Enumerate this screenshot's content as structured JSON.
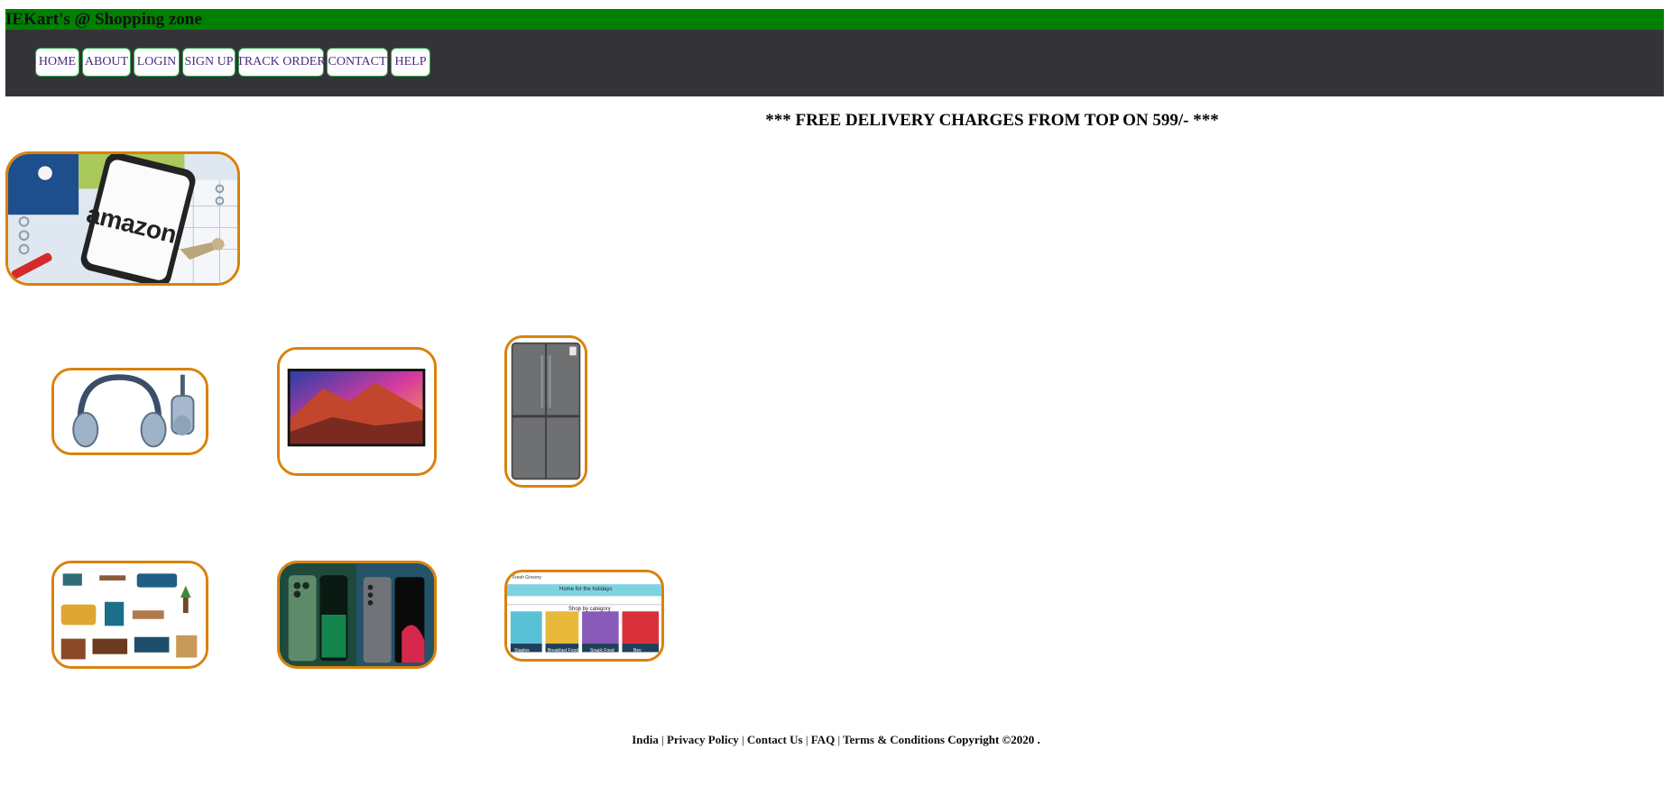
{
  "header": {
    "brand": "IEKart's @ Shopping zone"
  },
  "nav": {
    "items": [
      {
        "label": "HOME"
      },
      {
        "label": "ABOUT"
      },
      {
        "label": "LOGIN"
      },
      {
        "label": "SIGN UP"
      },
      {
        "label": "TRACK ORDER"
      },
      {
        "label": "CONTACT"
      },
      {
        "label": "HELP"
      }
    ]
  },
  "announcement": "*** FREE DELIVERY CHARGES FROM TOP ON 599/- ***",
  "hero": {
    "logo_text": "amazon"
  },
  "product_thumbnails": {
    "grocery_header": "Fresh Grocery",
    "grocery_banner": "Home for the holidays",
    "grocery_section": "Shop by category",
    "grocery_tiles": [
      "Staples",
      "Breakfast Food",
      "Snack Food",
      "Bev"
    ]
  },
  "footer": {
    "links": [
      "India",
      "Privacy Policy",
      "Contact Us",
      "FAQ",
      "Terms & Conditions"
    ],
    "separator": "|",
    "copyright": "Copyright ©2020 ."
  },
  "colors": {
    "topbar": "#008000",
    "navbar": "#343338",
    "nav_border": "#2ea84a",
    "nav_text": "#4b2a83",
    "frame_border": "#d9820b"
  }
}
